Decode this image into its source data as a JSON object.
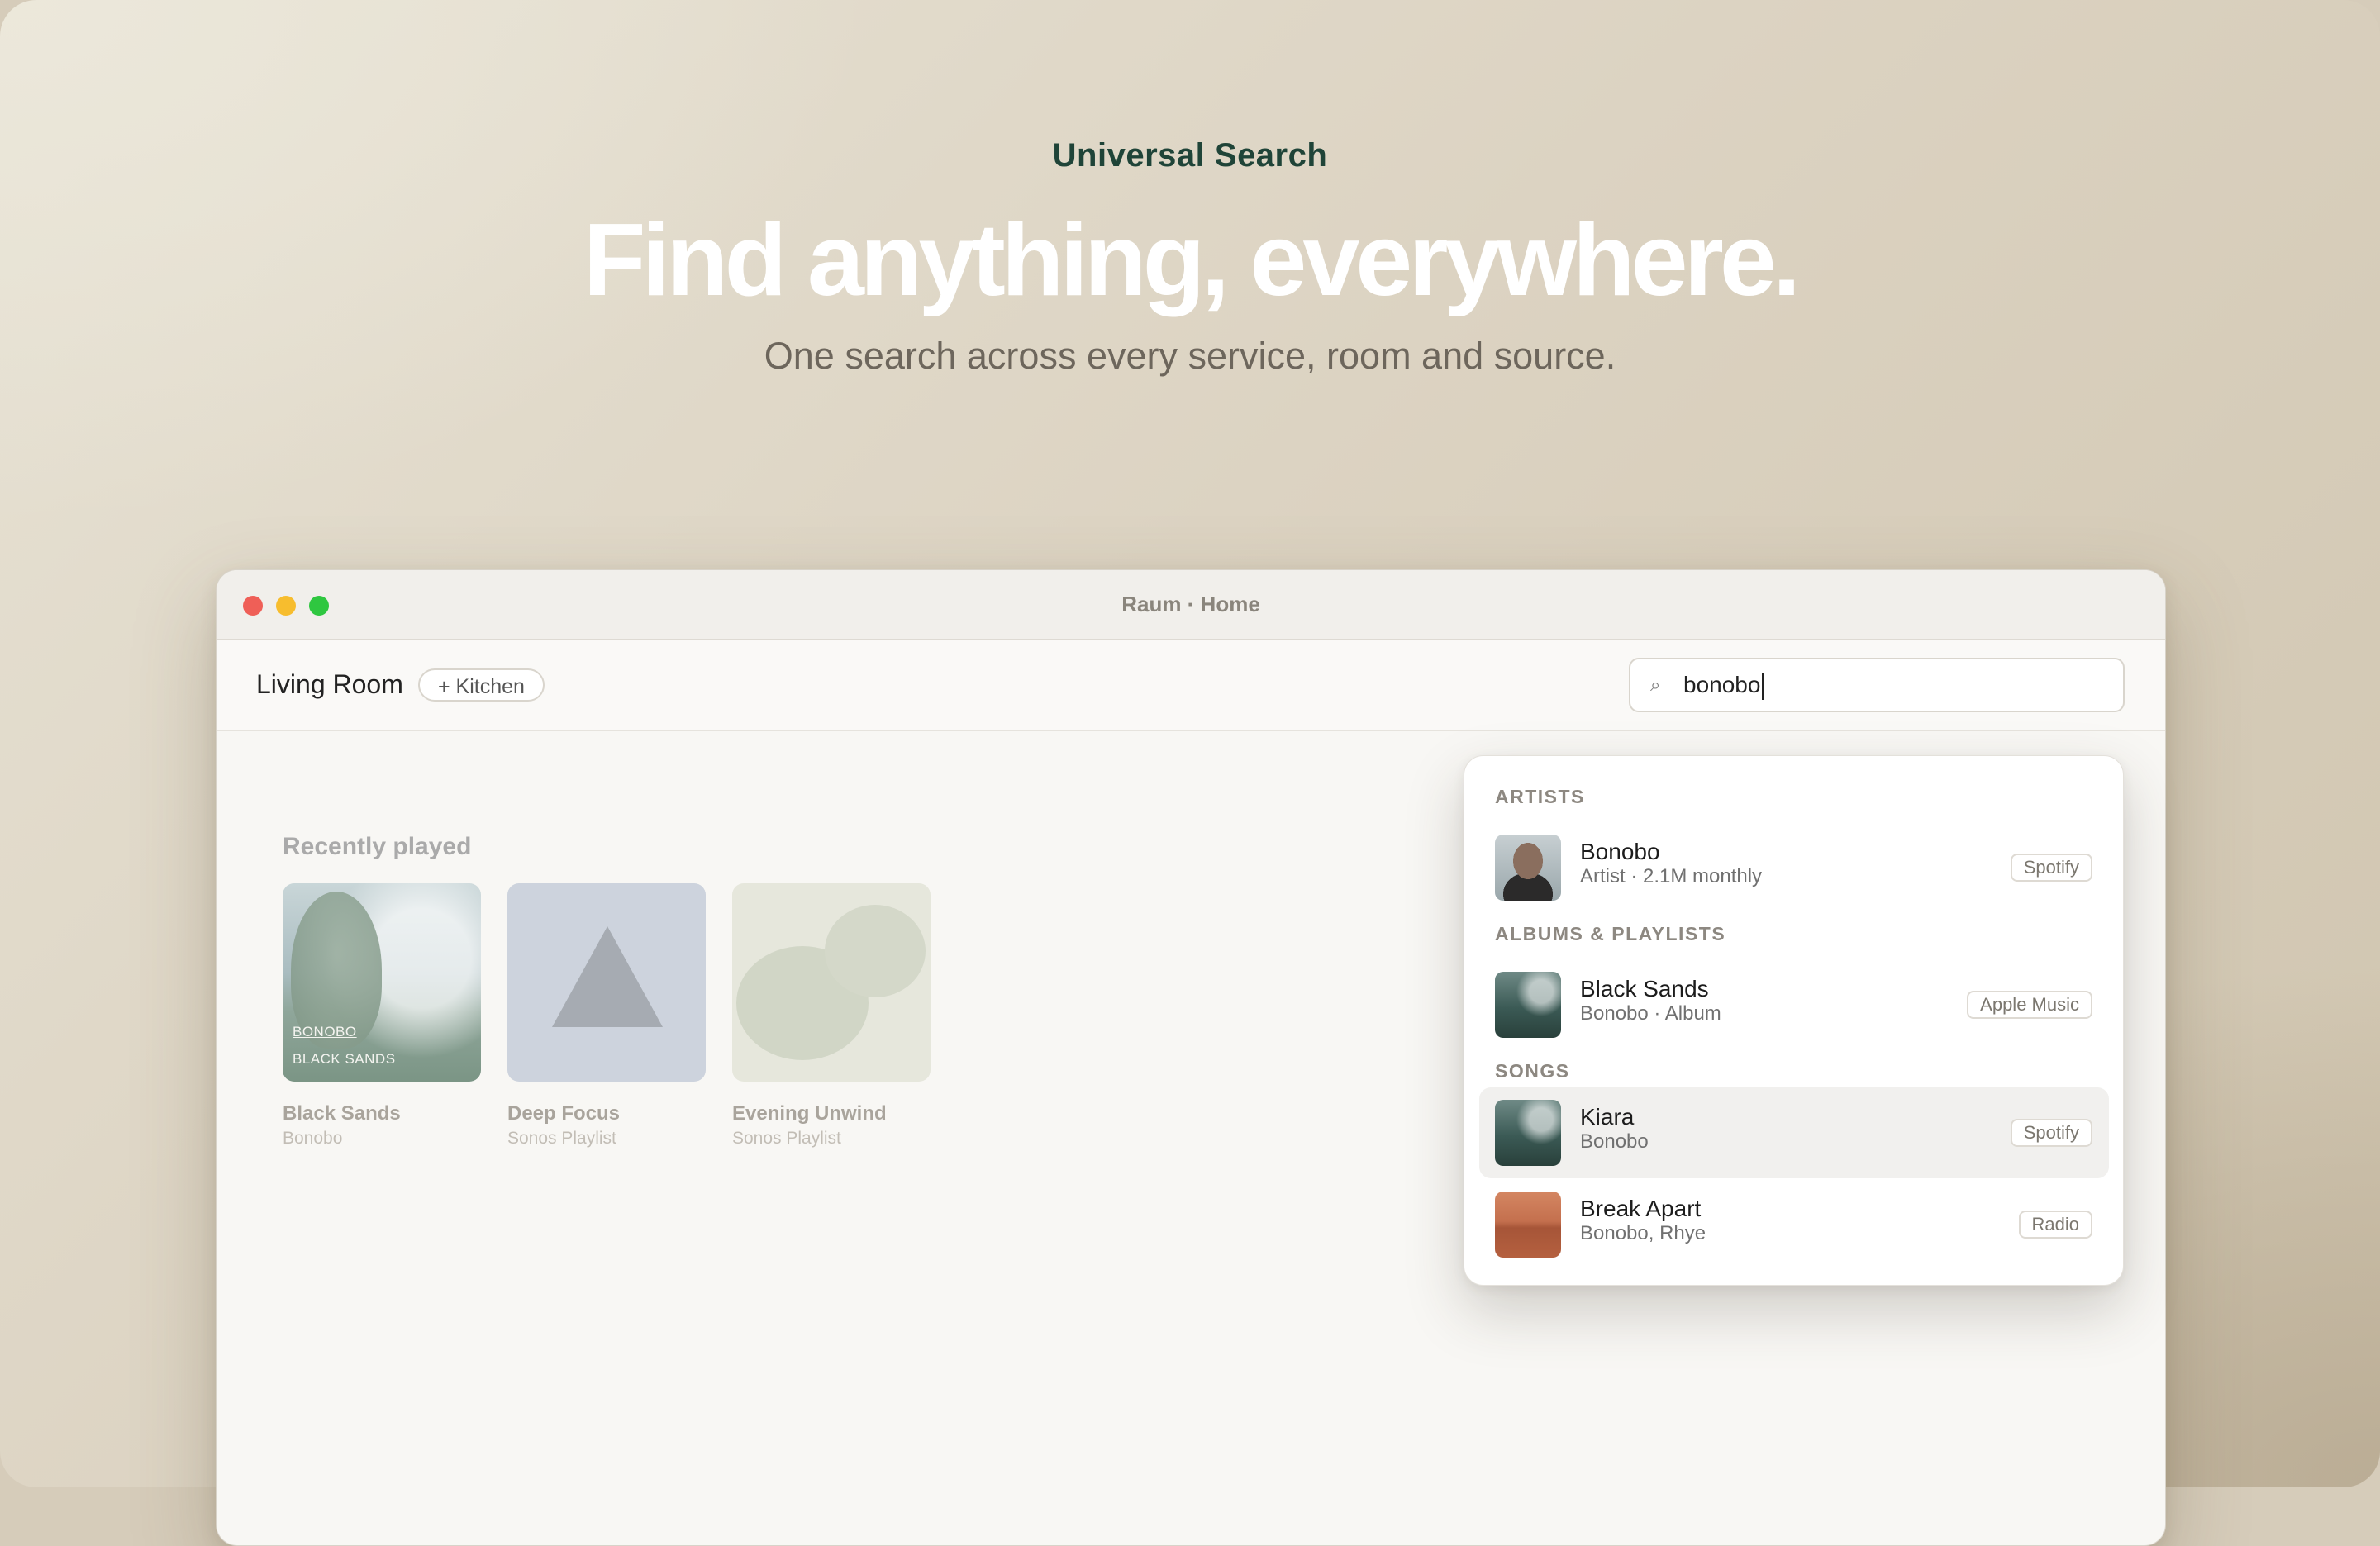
{
  "hero": {
    "eyebrow": "Universal Search",
    "headline": "Find anything, everywhere.",
    "subhead": "One search across every service, room and source."
  },
  "window": {
    "title": "Raum · Home"
  },
  "toolbar": {
    "room": "Living Room",
    "add_room_chip": "+ Kitchen",
    "search_icon": "search-icon",
    "search_value": "bonobo"
  },
  "recently_played": {
    "title": "Recently played",
    "items": [
      {
        "name": "Black Sands",
        "sub": "Bonobo",
        "art_line1": "BONOBO",
        "art_line2": "BLACK SANDS"
      },
      {
        "name": "Deep Focus",
        "sub": "Sonos Playlist"
      },
      {
        "name": "Evening Unwind",
        "sub": "Sonos Playlist"
      }
    ]
  },
  "results": {
    "artists_header": "ARTISTS",
    "albums_header": "ALBUMS & PLAYLISTS",
    "songs_header": "SONGS",
    "artists": [
      {
        "title": "Bonobo",
        "sub": "Artist · 2.1M monthly",
        "source": "Spotify"
      }
    ],
    "albums": [
      {
        "title": "Black Sands",
        "sub": "Bonobo · Album",
        "source": "Apple Music"
      }
    ],
    "songs": [
      {
        "title": "Kiara",
        "sub": "Bonobo",
        "source": "Spotify"
      },
      {
        "title": "Break Apart",
        "sub": "Bonobo, Rhye",
        "source": "Radio"
      }
    ]
  },
  "colors": {
    "accent_green": "#1f4438",
    "traffic_red": "#ef5f57",
    "traffic_yellow": "#f7bd2e",
    "traffic_green": "#2fc740"
  }
}
